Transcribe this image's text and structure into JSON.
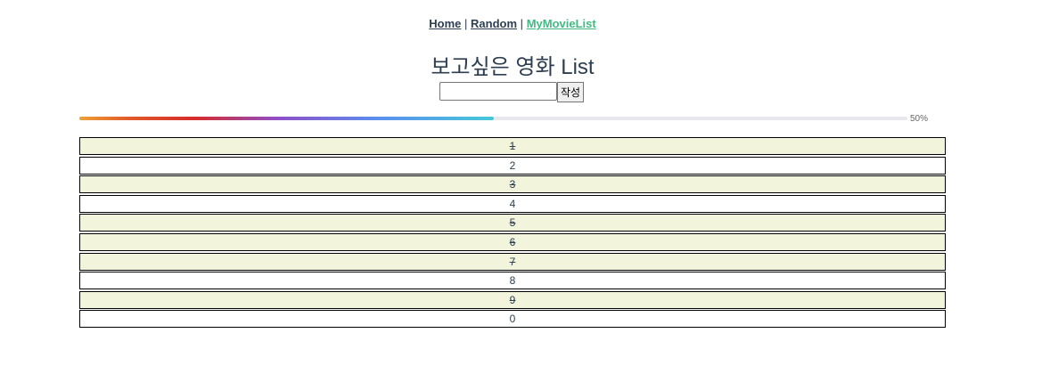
{
  "nav": {
    "home": "Home",
    "sep1": "|",
    "random": "Random",
    "sep2": "|",
    "mymovielist": "MyMovieList"
  },
  "page_title": "보고싶은 영화 List",
  "form": {
    "input_value": "",
    "submit_label": "작성"
  },
  "progress": {
    "percent": 50,
    "label": "50%"
  },
  "movies": [
    {
      "label": "1",
      "watched": true
    },
    {
      "label": "2",
      "watched": false
    },
    {
      "label": "3",
      "watched": true
    },
    {
      "label": "4",
      "watched": false
    },
    {
      "label": "5",
      "watched": true
    },
    {
      "label": "6",
      "watched": true
    },
    {
      "label": "7",
      "watched": true
    },
    {
      "label": "8",
      "watched": false
    },
    {
      "label": "9",
      "watched": true
    },
    {
      "label": "0",
      "watched": false
    }
  ]
}
